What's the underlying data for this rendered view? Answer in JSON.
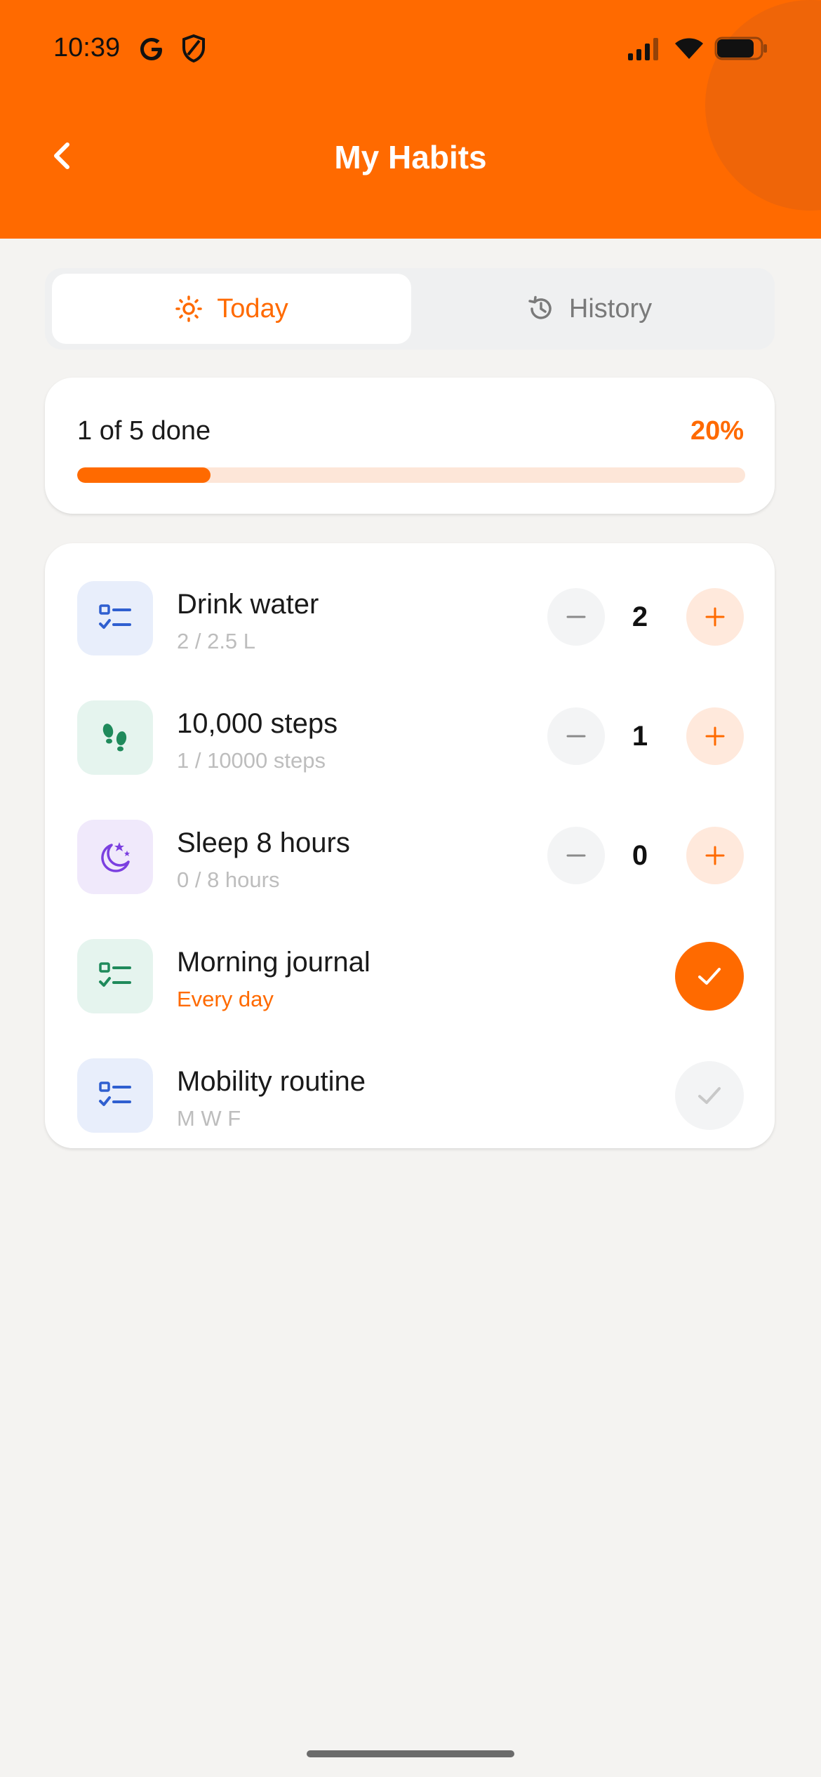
{
  "status_bar": {
    "time": "10:39"
  },
  "header": {
    "title": "My Habits"
  },
  "tabs": [
    {
      "label": "Today",
      "active": true,
      "icon": "sun-icon"
    },
    {
      "label": "History",
      "active": false,
      "icon": "history-icon"
    }
  ],
  "progress": {
    "text": "1 of 5 done",
    "percent_label": "20%",
    "fraction": 0.2
  },
  "habits": [
    {
      "name": "Drink water",
      "sub": "2 / 2.5 L",
      "type": "counter",
      "value": "2",
      "icon": "checklist-icon",
      "icon_color": "#2f5fd0",
      "icon_bg": "#e8eefb"
    },
    {
      "name": "10,000 steps",
      "sub": "1 / 10000 steps",
      "type": "counter",
      "value": "1",
      "icon": "footsteps-icon",
      "icon_color": "#1f8a5b",
      "icon_bg": "#e5f4ee"
    },
    {
      "name": "Sleep 8 hours",
      "sub": "0 / 8 hours",
      "type": "counter",
      "value": "0",
      "icon": "moon-stars-icon",
      "icon_color": "#7b3fe0",
      "icon_bg": "#f0e9fb"
    },
    {
      "name": "Morning journal",
      "sub": "Every day",
      "type": "check",
      "done": true,
      "icon": "checklist-icon",
      "icon_color": "#1f8a5b",
      "icon_bg": "#e5f4ee"
    },
    {
      "name": "Mobility routine",
      "sub": "M W F",
      "type": "check",
      "done": false,
      "icon": "checklist-icon",
      "icon_color": "#2f5fd0",
      "icon_bg": "#e8eefb"
    }
  ],
  "colors": {
    "accent": "#ff6a00",
    "background": "#f4f3f1"
  }
}
